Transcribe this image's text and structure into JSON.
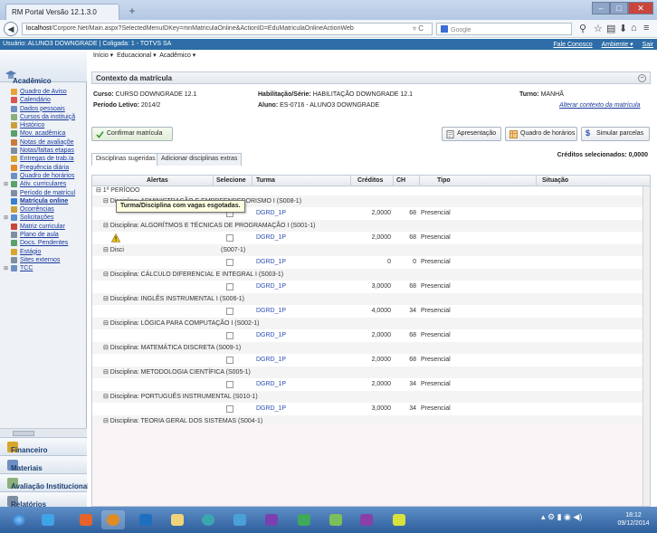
{
  "browser": {
    "tab_title": "RM Portal Versão 12.1.3.0",
    "url_host": "localhost",
    "url_path": "/Corpore.Net/Main.aspx?SelectedMenuIDKey=mnMatriculaOnline&ActionID=EduMatriculaOnlineActionWeb",
    "search_placeholder": "Google"
  },
  "appbar": {
    "left_text": "Usuário: ALUNO3 DOWNGRADE  |  Coligada: 1 - TOTVS SA",
    "fale_conosco": "Fale Conosco",
    "ambiente": "Ambiente ▾",
    "sair": "Sair"
  },
  "sidebar": {
    "title": "Acadêmico",
    "items": [
      {
        "label": "Quadro de Aviso",
        "icon": "bulletin-icon"
      },
      {
        "label": "Calendário",
        "icon": "calendar-icon"
      },
      {
        "label": "Dados pessoais",
        "icon": "person-icon"
      },
      {
        "label": "Cursos da instituiçã",
        "icon": "course-icon"
      },
      {
        "label": "Histórico",
        "icon": "history-icon"
      },
      {
        "label": "Mov. acadêmica",
        "icon": "movement-icon"
      },
      {
        "label": "Notas de avaliaçõe",
        "icon": "grades-icon"
      },
      {
        "label": "Notas/faltas etapas",
        "icon": "grades-icon"
      },
      {
        "label": "Entregas de trab./a",
        "icon": "assignment-icon"
      },
      {
        "label": "Frequência diária",
        "icon": "attendance-icon"
      },
      {
        "label": "Quadro de horários",
        "icon": "schedule-icon"
      },
      {
        "label": "Ativ. curriculares",
        "icon": "activity-icon"
      },
      {
        "label": "Período de matrícul",
        "icon": "period-icon"
      },
      {
        "label": "Matrícula online",
        "icon": "enrollment-icon"
      },
      {
        "label": "Ocorrências",
        "icon": "occurrence-icon"
      },
      {
        "label": "Solicitações",
        "icon": "request-icon"
      },
      {
        "label": "Matriz curricular",
        "icon": "matrix-icon"
      },
      {
        "label": "Plano de aula",
        "icon": "lesson-plan-icon"
      },
      {
        "label": "Docs. Pendentes",
        "icon": "documents-icon"
      },
      {
        "label": "Estágio",
        "icon": "internship-icon"
      },
      {
        "label": "Sites externos",
        "icon": "sites-icon"
      },
      {
        "label": "TCC",
        "icon": "tcc-icon"
      }
    ],
    "sections": [
      "Financeiro",
      "Materiais",
      "Avaliação Institucional",
      "Relatórios"
    ]
  },
  "menu": {
    "items": [
      "Início ▾",
      "Educacional ▾",
      "Acadêmico ▾"
    ]
  },
  "context": {
    "title": "Contexto da matrícula",
    "curso_label": "Curso:",
    "curso_value": "CURSO DOWNGRADE 12.1",
    "habilitacao_label": "Habilitação/Série:",
    "habilitacao_value": "HABILITAÇÃO DOWNGRADE 12.1",
    "turno_label": "Turno:",
    "turno_value": "MANHÃ",
    "periodo_label": "Período Letivo:",
    "periodo_value": "2014/2",
    "aluno_label": "Aluno:",
    "aluno_value": "ES-0716 - ALUNO3 DOWNGRADE",
    "alterar_link": "Alterar contexto da matrícula"
  },
  "toolbar": {
    "confirm": "Confirmar matrícula",
    "apresentacao": "Apresentação",
    "quadro": "Quadro de horários",
    "simular": "Simular parcelas",
    "creditos": "Créditos selecionados: 0,0000"
  },
  "tabs": {
    "sugeridas": "Disciplinas sugeridas",
    "adicionar": "Adicionar disciplinas extras"
  },
  "grid": {
    "headers": {
      "alertas": "Alertas",
      "selecione": "Selecione",
      "turma": "Turma",
      "creditos": "Créditos",
      "ch": "CH",
      "tipo": "Tipo",
      "situacao": "Situação"
    },
    "group": "⊟ 1º PERÍODO",
    "tooltip": "Turma/Disciplina com vagas esgotadas.",
    "tooltip_hidden_tail": "(S007-1)",
    "disciplines": [
      {
        "title": "⊟ Disciplina: ADMINISTRAÇÃO E EMPREENDEDORISMO I (S008-1)",
        "turma": "DGRD_1P",
        "creditos": "2,0000",
        "ch": "68",
        "tipo": "Presencial",
        "warn": false
      },
      {
        "title": "⊟ Disciplina: ALGORÍTMOS E TÉCNICAS DE PROGRAMAÇÃO I (S001-1)",
        "turma": "DGRD_1P",
        "creditos": "2,0000",
        "ch": "68",
        "tipo": "Presencial",
        "warn": true
      },
      {
        "title": "⊟ Disci",
        "turma": "DGRD_1P",
        "creditos": "0",
        "ch": "0",
        "tipo": "Presencial",
        "warn": false
      },
      {
        "title": "⊟ Disciplina: CÁLCULO DIFERENCIAL E INTEGRAL I (S003-1)",
        "turma": "DGRD_1P",
        "creditos": "3,0000",
        "ch": "68",
        "tipo": "Presencial",
        "warn": false
      },
      {
        "title": "⊟ Disciplina: INGLÊS INSTRUMENTAL I (S006-1)",
        "turma": "DGRD_1P",
        "creditos": "4,0000",
        "ch": "34",
        "tipo": "Presencial",
        "warn": false
      },
      {
        "title": "⊟ Disciplina: LÓGICA PARA COMPUTAÇÃO I (S002-1)",
        "turma": "DGRD_1P",
        "creditos": "2,0000",
        "ch": "68",
        "tipo": "Presencial",
        "warn": false
      },
      {
        "title": "⊟ Disciplina: MATEMÁTICA DISCRETA (S009-1)",
        "turma": "DGRD_1P",
        "creditos": "2,0000",
        "ch": "68",
        "tipo": "Presencial",
        "warn": false
      },
      {
        "title": "⊟ Disciplina: METODOLOGIA CIENTÍFICA (S005-1)",
        "turma": "DGRD_1P",
        "creditos": "2,0000",
        "ch": "34",
        "tipo": "Presencial",
        "warn": false
      },
      {
        "title": "⊟ Disciplina: PORTUGUÊS INSTRUMENTAL (S010-1)",
        "turma": "DGRD_1P",
        "creditos": "3,0000",
        "ch": "34",
        "tipo": "Presencial",
        "warn": false
      },
      {
        "title": "⊟ Disciplina: TEORIA GERAL DOS SISTEMAS (S004-1)",
        "turma": "DGRD_1P",
        "creditos": "3,0000",
        "ch": "68",
        "tipo": "Presencial",
        "warn": false
      }
    ]
  },
  "taskbar": {
    "time": "18:12",
    "date": "09/12/2014"
  },
  "colors": {
    "appbar": "#2d6ca6",
    "link": "#1a3a9c",
    "warning": "#e8c51c"
  }
}
